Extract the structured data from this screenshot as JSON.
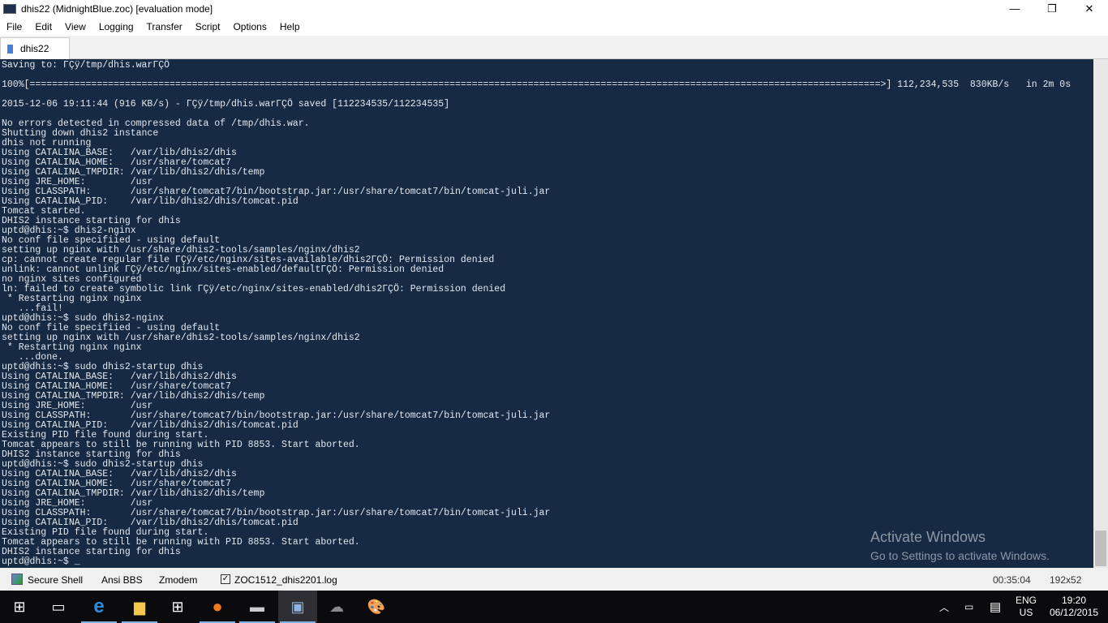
{
  "window": {
    "title": "dhis22 (MidnightBlue.zoc) [evaluation mode]",
    "minimize": "—",
    "maximize": "❐",
    "close": "✕"
  },
  "menu": [
    "File",
    "Edit",
    "View",
    "Logging",
    "Transfer",
    "Script",
    "Options",
    "Help"
  ],
  "tab": {
    "label": "dhis22"
  },
  "terminal": {
    "lines": [
      "Saving to: ΓÇÿ/tmp/dhis.warΓÇÖ",
      "",
      "100%[========================================================================================================================================================>] 112,234,535  830KB/s   in 2m 0s",
      "",
      "2015-12-06 19:11:44 (916 KB/s) - ΓÇÿ/tmp/dhis.warΓÇÖ saved [112234535/112234535]",
      "",
      "No errors detected in compressed data of /tmp/dhis.war.",
      "Shutting down dhis2 instance",
      "dhis not running",
      "Using CATALINA_BASE:   /var/lib/dhis2/dhis",
      "Using CATALINA_HOME:   /usr/share/tomcat7",
      "Using CATALINA_TMPDIR: /var/lib/dhis2/dhis/temp",
      "Using JRE_HOME:        /usr",
      "Using CLASSPATH:       /usr/share/tomcat7/bin/bootstrap.jar:/usr/share/tomcat7/bin/tomcat-juli.jar",
      "Using CATALINA_PID:    /var/lib/dhis2/dhis/tomcat.pid",
      "Tomcat started.",
      "DHIS2 instance starting for dhis",
      "uptd@dhis:~$ dhis2-nginx",
      "No conf file specifiied - using default",
      "setting up nginx with /usr/share/dhis2-tools/samples/nginx/dhis2",
      "cp: cannot create regular file ΓÇÿ/etc/nginx/sites-available/dhis2ΓÇÖ: Permission denied",
      "unlink: cannot unlink ΓÇÿ/etc/nginx/sites-enabled/defaultΓÇÖ: Permission denied",
      "no nginx sites configured",
      "ln: failed to create symbolic link ΓÇÿ/etc/nginx/sites-enabled/dhis2ΓÇÖ: Permission denied",
      " * Restarting nginx nginx",
      "   ...fail!",
      "uptd@dhis:~$ sudo dhis2-nginx",
      "No conf file specifiied - using default",
      "setting up nginx with /usr/share/dhis2-tools/samples/nginx/dhis2",
      " * Restarting nginx nginx",
      "   ...done.",
      "uptd@dhis:~$ sudo dhis2-startup dhis",
      "Using CATALINA_BASE:   /var/lib/dhis2/dhis",
      "Using CATALINA_HOME:   /usr/share/tomcat7",
      "Using CATALINA_TMPDIR: /var/lib/dhis2/dhis/temp",
      "Using JRE_HOME:        /usr",
      "Using CLASSPATH:       /usr/share/tomcat7/bin/bootstrap.jar:/usr/share/tomcat7/bin/tomcat-juli.jar",
      "Using CATALINA_PID:    /var/lib/dhis2/dhis/tomcat.pid",
      "Existing PID file found during start.",
      "Tomcat appears to still be running with PID 8853. Start aborted.",
      "DHIS2 instance starting for dhis",
      "uptd@dhis:~$ sudo dhis2-startup dhis",
      "Using CATALINA_BASE:   /var/lib/dhis2/dhis",
      "Using CATALINA_HOME:   /usr/share/tomcat7",
      "Using CATALINA_TMPDIR: /var/lib/dhis2/dhis/temp",
      "Using JRE_HOME:        /usr",
      "Using CLASSPATH:       /usr/share/tomcat7/bin/bootstrap.jar:/usr/share/tomcat7/bin/tomcat-juli.jar",
      "Using CATALINA_PID:    /var/lib/dhis2/dhis/tomcat.pid",
      "Existing PID file found during start.",
      "Tomcat appears to still be running with PID 8853. Start aborted.",
      "DHIS2 instance starting for dhis",
      "uptd@dhis:~$ _"
    ]
  },
  "watermark": {
    "title": "Activate Windows",
    "subtitle": "Go to Settings to activate Windows."
  },
  "status": {
    "protocol": "Secure Shell",
    "emulation": "Ansi BBS",
    "transfer": "Zmodem",
    "logfile": "ZOC1512_dhis2201.log",
    "elapsed": "00:35:04",
    "size": "192x52"
  },
  "tray": {
    "lang1": "ENG",
    "lang2": "US",
    "time": "19:20",
    "date": "06/12/2015"
  }
}
